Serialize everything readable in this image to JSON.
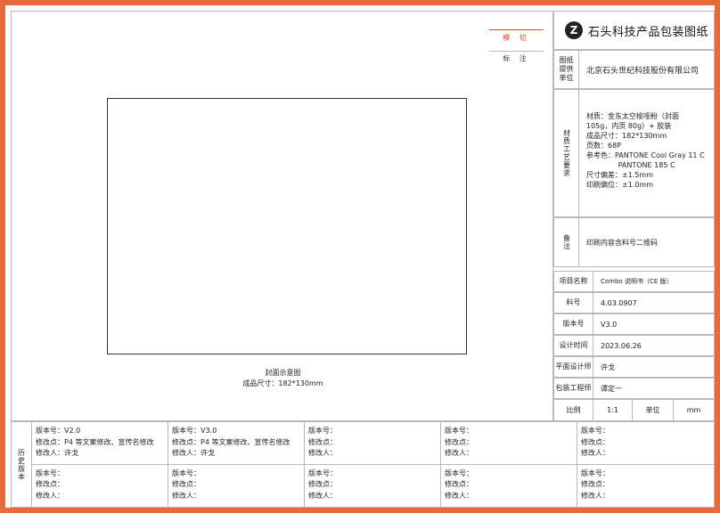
{
  "legend": {
    "cut_label": "模 切",
    "mark_label": "标 注"
  },
  "cover": {
    "caption": "封面示意图",
    "size": "成品尺寸：182*130mm"
  },
  "brand": {
    "logo_glyph": "Z",
    "title": "石头科技产品包装图纸"
  },
  "supplier": {
    "label": "图纸提供单位",
    "value": "北京石头世纪科技股份有限公司"
  },
  "spec": {
    "label": "材质工艺要求",
    "lines": "材质：金东太空梭哑粉（封面\n105g，内页 80g）+ 胶装\n成品尺寸：182*130mm\n页数：68P\n参考色：PANTONE Cool Gray 11 C\n              PANTONE 185 C\n尺寸偏差：±1.5mm\n印刷偏位：±1.0mm"
  },
  "remark": {
    "label": "备注",
    "value": "印刷内容含料号二维码"
  },
  "info": {
    "project_label": "项目名称",
    "project_value": "Combo 说明书（CE 版）",
    "part_label": "料号",
    "part_value": "4.03.0907",
    "version_label": "版本号",
    "version_value": "V3.0",
    "design_time_label": "设计时间",
    "design_time_value": "2023.06.26",
    "designer_label": "平面设计师",
    "designer_value": "许戈",
    "engineer_label": "包装工程师",
    "engineer_value": "谭定一",
    "scale_label": "比例",
    "scale_value": "1:1",
    "unit_label": "单位",
    "unit_value": "mm"
  },
  "history": {
    "label": "历史版本",
    "cells": [
      "版本号：V2.0\n修改点：P4 等文案修改、宣传名修改\n修改人：许戈",
      "版本号：V3.0\n修改点：P4 等文案修改、宣传名修改\n修改人：许戈",
      "版本号：\n修改点：\n修改人：",
      "版本号：\n修改点：\n修改人：",
      "版本号：\n修改点：\n修改人：",
      "版本号：\n修改点：\n修改人：",
      "版本号：\n修改点：\n修改人：",
      "版本号：\n修改点：\n修改人：",
      "版本号：\n修改点：\n修改人：",
      "版本号：\n修改点：\n修改人："
    ]
  }
}
